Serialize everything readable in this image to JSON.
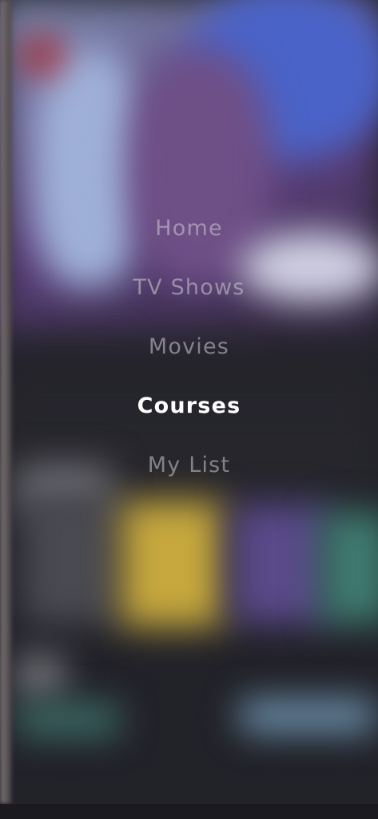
{
  "menu": {
    "items": [
      {
        "label": "Home",
        "active": false
      },
      {
        "label": "TV Shows",
        "active": false
      },
      {
        "label": "Movies",
        "active": false
      },
      {
        "label": "Courses",
        "active": true
      },
      {
        "label": "My List",
        "active": false
      }
    ]
  },
  "colors": {
    "active_text": "#ffffff",
    "inactive_text": "#8e8e93",
    "overlay_background": "#222229"
  }
}
